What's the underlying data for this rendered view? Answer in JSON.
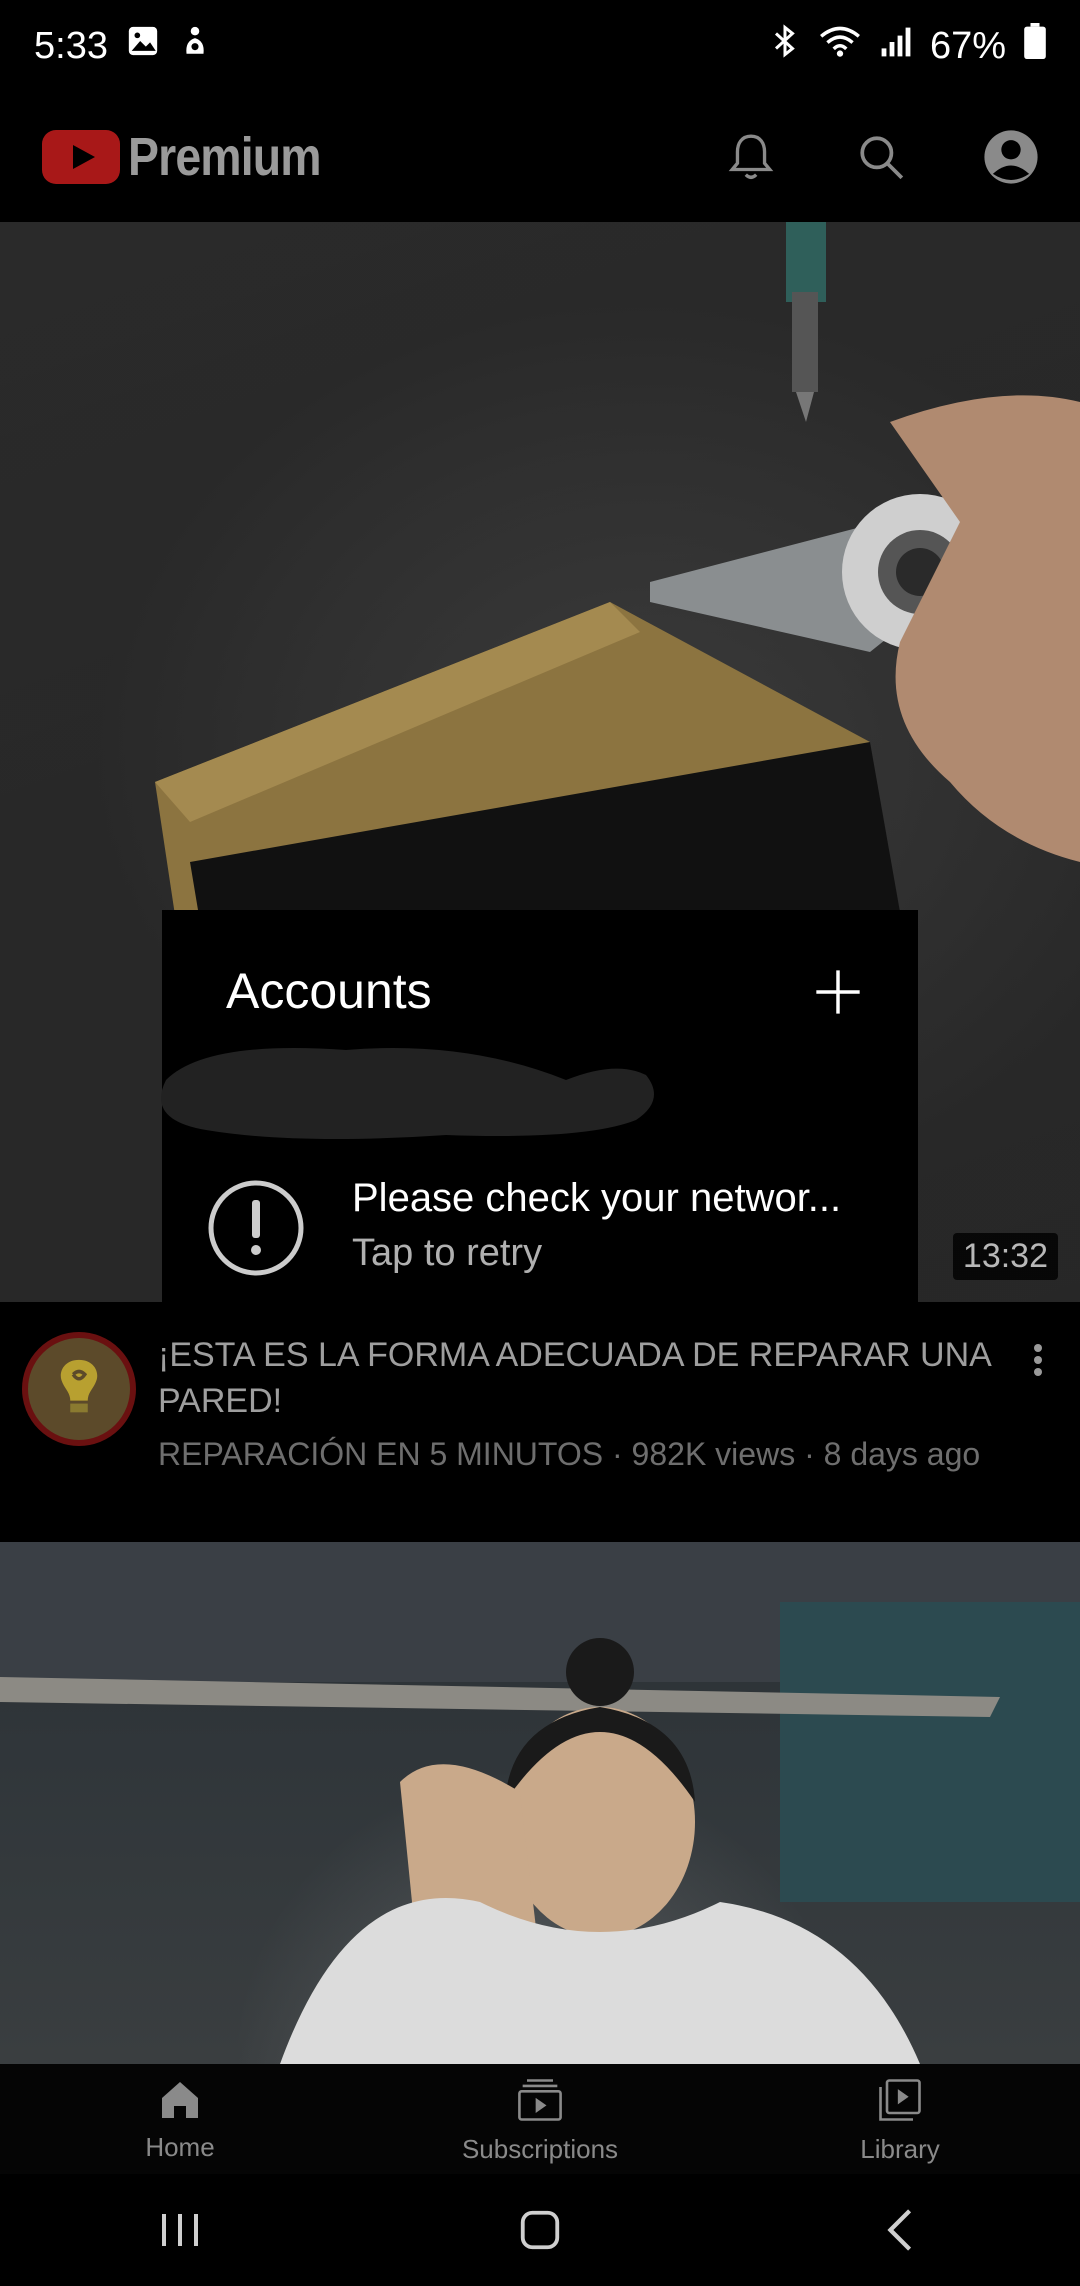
{
  "status_bar": {
    "time": "5:33",
    "battery": "67%"
  },
  "header": {
    "logo_text": "Premium",
    "brand_color": "#d21f1f",
    "icons": [
      "bell-icon",
      "search-icon",
      "account-icon"
    ]
  },
  "video1": {
    "duration": "13:32",
    "title": "¡ESTA ES LA FORMA ADECUADA DE REPARAR UNA PARED!",
    "meta": "REPARACIÓN EN 5 MINUTOS · 982K views · 8 days ago"
  },
  "accounts_popup": {
    "title": "Accounts",
    "error_message": "Please check your networ...",
    "retry_label": "Tap to retry"
  },
  "bottom_nav": {
    "items": [
      {
        "label": "Home",
        "icon": "home-icon"
      },
      {
        "label": "Subscriptions",
        "icon": "subscriptions-icon"
      },
      {
        "label": "Library",
        "icon": "library-icon"
      }
    ]
  }
}
